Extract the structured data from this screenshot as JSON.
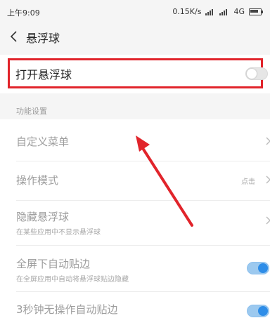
{
  "status_bar": {
    "time": "上午9:09",
    "network_speed": "0.15K/s",
    "network_type": "4G"
  },
  "header": {
    "title": "悬浮球"
  },
  "main_toggle": {
    "label": "打开悬浮球",
    "on": false
  },
  "section": {
    "title": "功能设置"
  },
  "items": [
    {
      "title": "自定义菜单"
    },
    {
      "title": "操作模式",
      "value": "点击"
    },
    {
      "title": "隐藏悬浮球",
      "subtitle": "在某些应用中不显示悬浮球"
    },
    {
      "title": "全屏下自动贴边",
      "subtitle": "在全屏应用中自动将悬浮球贴边隐藏",
      "on": true
    },
    {
      "title": "3秒钟无操作自动贴边",
      "on": true
    }
  ],
  "colors": {
    "highlight": "#e1242b",
    "arrow": "#e1242b",
    "toggle_on": "#2e8de8"
  }
}
